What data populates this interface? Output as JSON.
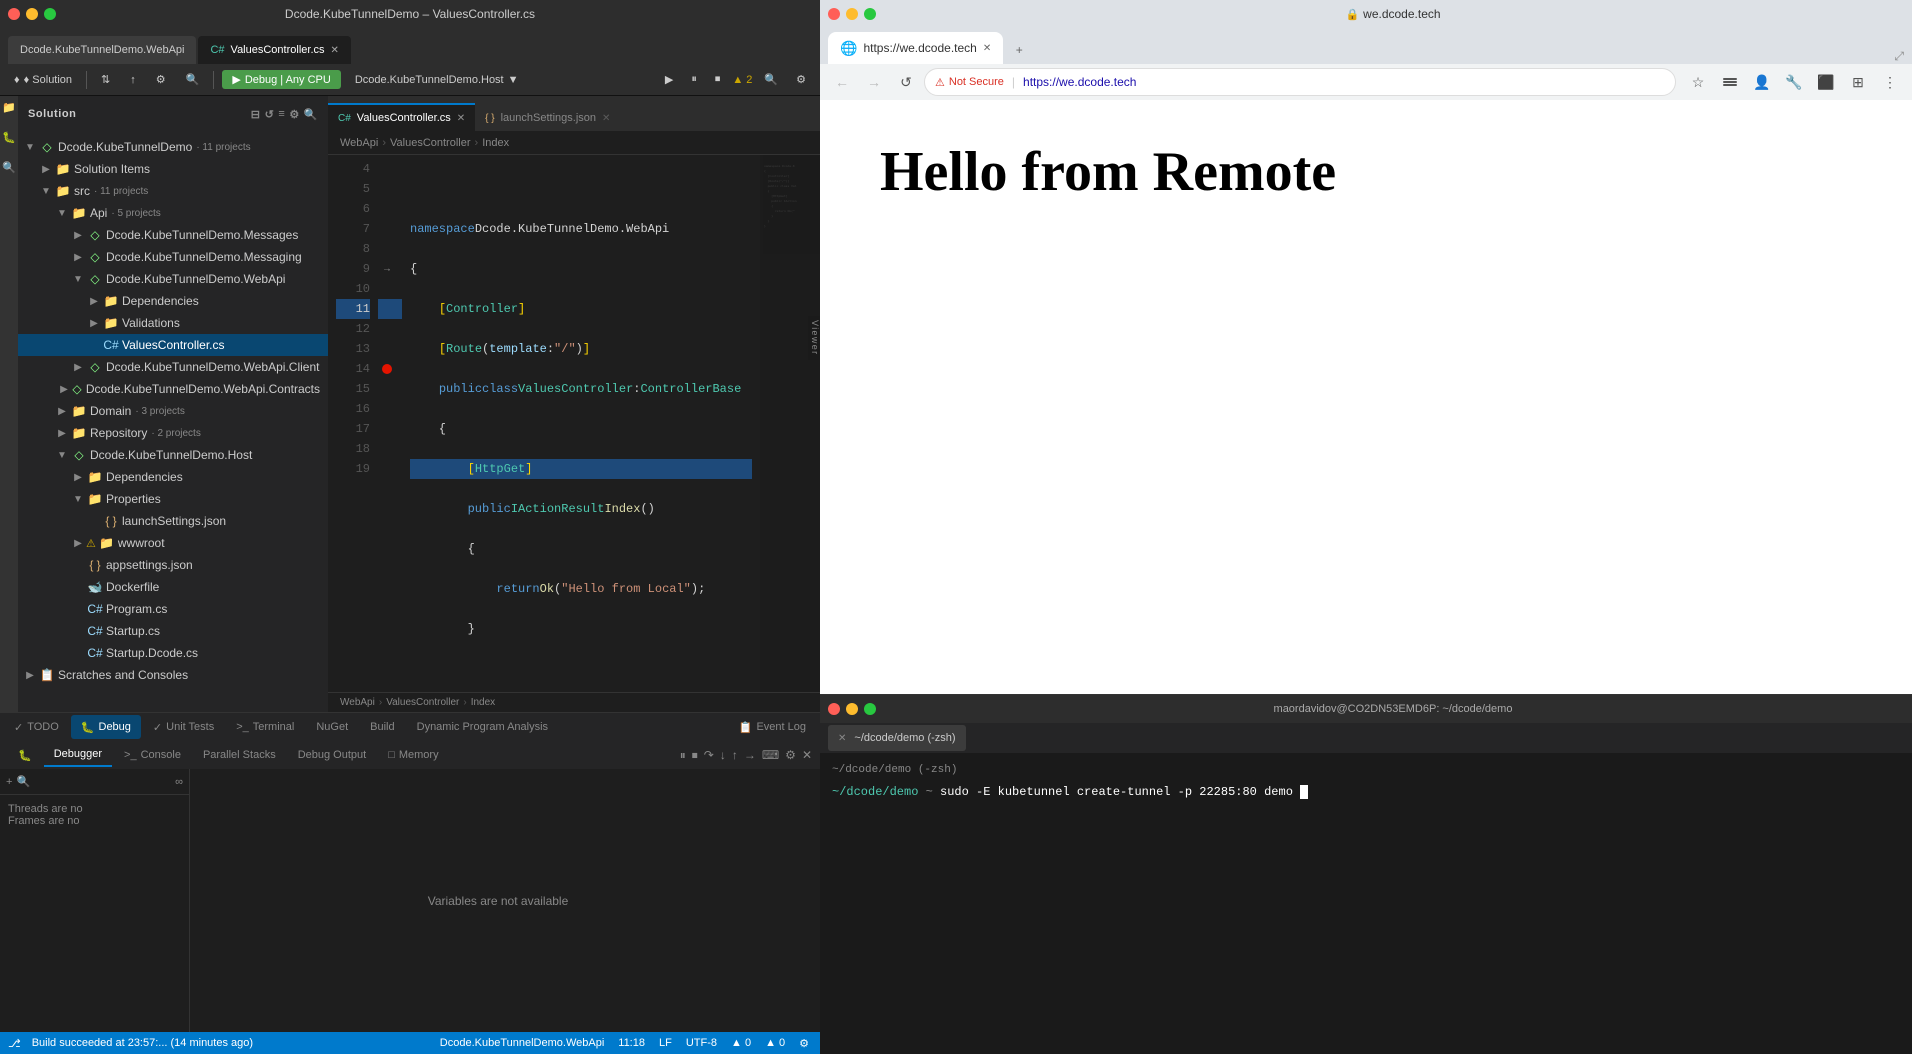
{
  "app": {
    "title": "Dcode.KubeTunnelDemo – ValuesController.cs"
  },
  "title_bar": {
    "title": "Dcode.KubeTunnelDemo – ValuesController.cs",
    "tabs": [
      {
        "label": "Dcode.KubeTunnelDemo.WebApi",
        "active": false
      },
      {
        "label": "ValuesController.cs",
        "icon": "cs",
        "active": true
      }
    ]
  },
  "toolbar": {
    "solution_label": "♦ Solution",
    "debug_label": "▶ Debug | Any CPU",
    "target_label": "Dcode.KubeTunnelDemo.Host",
    "run_icon": "▶",
    "warning_count": "▲ 2"
  },
  "editor_tabs": [
    {
      "label": "ValuesController.cs",
      "icon": "cs",
      "active": true
    },
    {
      "label": "launchSettings.json",
      "active": false
    }
  ],
  "breadcrumb": {
    "parts": [
      "WebApi",
      "ValuesController",
      "Index"
    ]
  },
  "code": {
    "lines": [
      {
        "num": 4,
        "content": ""
      },
      {
        "num": 5,
        "content": "namespace Dcode.KubeTunnelDemo.WebApi"
      },
      {
        "num": 6,
        "content": "{"
      },
      {
        "num": 7,
        "content": "    [Controller]"
      },
      {
        "num": 8,
        "content": "    [Route(template:\"/\")]"
      },
      {
        "num": 9,
        "content": "    public class ValuesController : ControllerBase"
      },
      {
        "num": 10,
        "content": "    {"
      },
      {
        "num": 11,
        "content": "        [HttpGet]",
        "highlighted": true
      },
      {
        "num": 12,
        "content": "        public IActionResult Index()"
      },
      {
        "num": 13,
        "content": "        {"
      },
      {
        "num": 14,
        "content": "            return Ok(\"Hello from Local\");",
        "breakpoint": true
      },
      {
        "num": 15,
        "content": "        }"
      },
      {
        "num": 16,
        "content": ""
      },
      {
        "num": 17,
        "content": "    }"
      },
      {
        "num": 18,
        "content": "}"
      },
      {
        "num": 19,
        "content": ""
      }
    ]
  },
  "file_tree": {
    "header": "Solution",
    "items": [
      {
        "label": "Dcode.KubeTunnelDemo",
        "type": "solution",
        "indent": 0,
        "expanded": true,
        "meta": "11 projects"
      },
      {
        "label": "Solution Items",
        "type": "folder",
        "indent": 1,
        "expanded": false
      },
      {
        "label": "src",
        "type": "folder",
        "indent": 1,
        "expanded": true,
        "meta": "11 projects"
      },
      {
        "label": "Api",
        "type": "folder",
        "indent": 2,
        "expanded": true,
        "meta": "5 projects"
      },
      {
        "label": "Dcode.KubeTunnelDemo.Messages",
        "type": "project",
        "indent": 3,
        "expanded": false
      },
      {
        "label": "Dcode.KubeTunnelDemo.Messaging",
        "type": "project",
        "indent": 3,
        "expanded": false
      },
      {
        "label": "Dcode.KubeTunnelDemo.WebApi",
        "type": "project",
        "indent": 3,
        "expanded": true,
        "selected": false
      },
      {
        "label": "Dependencies",
        "type": "folder",
        "indent": 4,
        "expanded": false
      },
      {
        "label": "Validations",
        "type": "folder",
        "indent": 4,
        "expanded": false
      },
      {
        "label": "ValuesController.cs",
        "type": "cs-file",
        "indent": 4,
        "selected": true
      },
      {
        "label": "Dcode.KubeTunnelDemo.WebApi.Client",
        "type": "project",
        "indent": 3,
        "expanded": false
      },
      {
        "label": "Dcode.KubeTunnelDemo.WebApi.Contracts",
        "type": "project",
        "indent": 3,
        "expanded": false
      },
      {
        "label": "Domain",
        "type": "folder",
        "indent": 2,
        "expanded": false,
        "meta": "3 projects"
      },
      {
        "label": "Repository",
        "type": "folder",
        "indent": 2,
        "expanded": false,
        "meta": "2 projects"
      },
      {
        "label": "Dcode.KubeTunnelDemo.Host",
        "type": "project",
        "indent": 2,
        "expanded": true
      },
      {
        "label": "Dependencies",
        "type": "folder",
        "indent": 3,
        "expanded": false
      },
      {
        "label": "Properties",
        "type": "folder",
        "indent": 3,
        "expanded": true
      },
      {
        "label": "launchSettings.json",
        "type": "json-file",
        "indent": 4
      },
      {
        "label": "wwwroot",
        "type": "folder",
        "indent": 3,
        "expanded": false,
        "warning": true
      },
      {
        "label": "appsettings.json",
        "type": "json-file",
        "indent": 3
      },
      {
        "label": "Dockerfile",
        "type": "file",
        "indent": 3
      },
      {
        "label": "Program.cs",
        "type": "cs-file",
        "indent": 3
      },
      {
        "label": "Startup.cs",
        "type": "cs-file",
        "indent": 3
      },
      {
        "label": "Startup.Dcode.cs",
        "type": "cs-file",
        "indent": 3
      },
      {
        "label": "Scratches and Consoles",
        "type": "folder",
        "indent": 0,
        "expanded": false
      }
    ]
  },
  "debug": {
    "tabs": [
      "Debugger",
      "Console",
      "Parallel Stacks",
      "Debug Output",
      "Memory"
    ],
    "active_tab": "Debugger",
    "variables_message": "Variables are not available",
    "threads_message": "Threads are no",
    "frames_message": "Frames are no"
  },
  "bottom_tabs": [
    {
      "label": "TODO",
      "active": false
    },
    {
      "label": "Debug",
      "active": true
    },
    {
      "label": "Unit Tests",
      "active": false
    },
    {
      "label": "Terminal",
      "active": false
    },
    {
      "label": "NuGet",
      "active": false
    },
    {
      "label": "Build",
      "active": false
    },
    {
      "label": "Dynamic Program Analysis",
      "active": false
    },
    {
      "label": "Event Log",
      "active": false
    }
  ],
  "status_bar": {
    "left": [
      "Build succeeded at 23:57:... (14 minutes ago)"
    ],
    "right": [
      "Dcode.KubeTunnelDemo.WebApi",
      "11:18",
      "LF",
      "UTF-8",
      "▲ 0",
      "▲ 0"
    ]
  },
  "browser": {
    "title": "we.dcode.tech",
    "url": "https://we.dcode.tech",
    "content": "Hello from Remote",
    "tab_label": "https://we.dcode.tech",
    "security": "Not Secure"
  },
  "terminal": {
    "title": "maordavidov@CO2DN53EMD6P: ~/dcode/demo",
    "tab_label": "~/dcode/demo (-zsh)",
    "working_dir": "~/dcode/demo (-zsh)",
    "prompt": "~/dcode/demo",
    "command": "sudo -E kubetunnel create-tunnel -p 22285:80 demo"
  }
}
